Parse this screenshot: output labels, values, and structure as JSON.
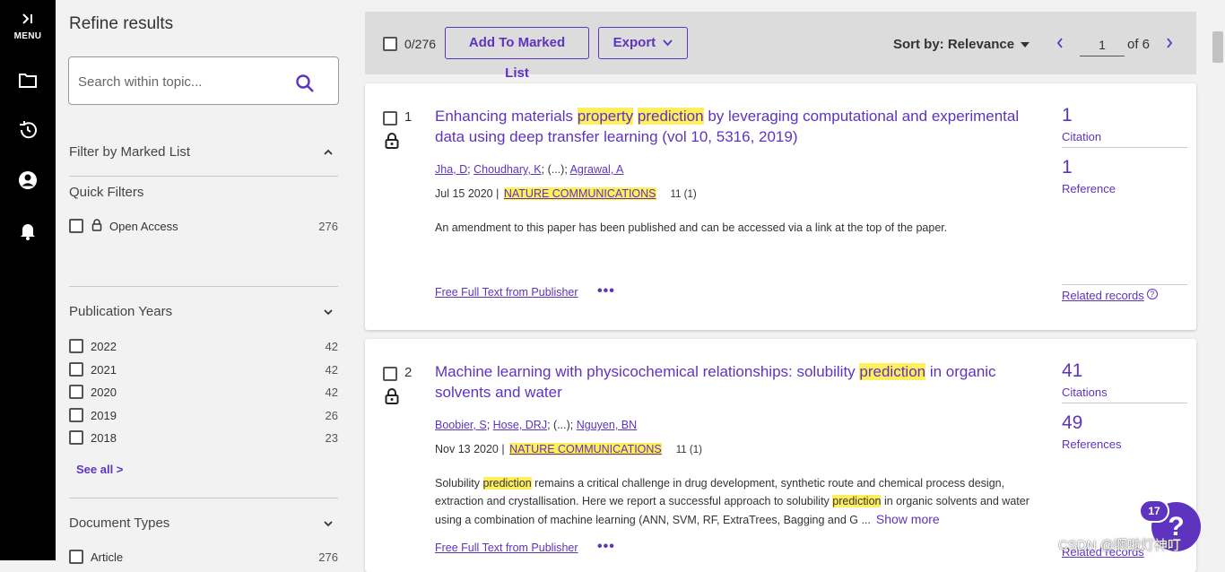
{
  "rail": {
    "menu_label": "MENU",
    "menu_chev": ">|"
  },
  "sidebar": {
    "title": "Refine results",
    "search_placeholder": "Search within topic...",
    "marked_list": "Filter by Marked List",
    "quick_filters": "Quick Filters",
    "open_access": {
      "label": "Open Access",
      "count": "276"
    },
    "pub_years_title": "Publication Years",
    "years": [
      {
        "label": "2022",
        "count": "42"
      },
      {
        "label": "2021",
        "count": "42"
      },
      {
        "label": "2020",
        "count": "42"
      },
      {
        "label": "2019",
        "count": "26"
      },
      {
        "label": "2018",
        "count": "23"
      }
    ],
    "see_all": "See all >",
    "doc_types_title": "Document Types",
    "doc_types": [
      {
        "label": "Article",
        "count": "276"
      }
    ]
  },
  "toolbar": {
    "selected": "0/276",
    "add_marked": "Add To Marked List",
    "export": "Export",
    "sort": "Sort by: Relevance",
    "page": "1",
    "of_pages": "of 6"
  },
  "results": [
    {
      "num": "1",
      "title_parts": [
        "Enhancing materials ",
        "property",
        " ",
        "prediction",
        " by leveraging computational and experimental data using deep transfer learning (vol 10, 5316, 2019)"
      ],
      "authors": [
        "Jha, D",
        "Choudhary, K",
        "Agrawal, A"
      ],
      "ellipsis": "(...)",
      "date": "Jul 15 2020",
      "journal": "NATURE COMMUNICATIONS",
      "volume": "11 (1)",
      "abstract": "An amendment to this paper has been published and can be accessed via a link at the top of the paper.",
      "full_text": "Free Full Text from Publisher",
      "dots": "•••",
      "citations_num": "1",
      "citations_label": "Citation",
      "references_num": "1",
      "references_label": "Reference",
      "related": "Related records"
    },
    {
      "num": "2",
      "title_parts": [
        "Machine learning with physicochemical relationships: solubility ",
        "prediction",
        " in organic solvents and water"
      ],
      "authors": [
        "Boobier, S",
        "Hose, DRJ",
        "Nguyen, BN"
      ],
      "ellipsis": "(...)",
      "date": "Nov 13 2020",
      "journal": "NATURE COMMUNICATIONS",
      "volume": "11 (1)",
      "abstract_parts": [
        "Solubility ",
        "prediction",
        " remains a critical challenge in drug development, synthetic route and chemical process design, extraction and crystallisation. Here we report a successful approach to solubility ",
        "prediction",
        " in organic solvents and water using a combination of machine learning (ANN, SVM, RF, ExtraTrees, Bagging and G ..."
      ],
      "show_more": "Show more",
      "full_text": "Free Full Text from Publisher",
      "dots": "•••",
      "citations_num": "41",
      "citations_label": "Citations",
      "references_num": "49",
      "references_label": "References",
      "related": "Related records"
    }
  ],
  "help": {
    "badge": "17",
    "icon": "?"
  },
  "watermark": "CSDN @啊啦灯神叮"
}
